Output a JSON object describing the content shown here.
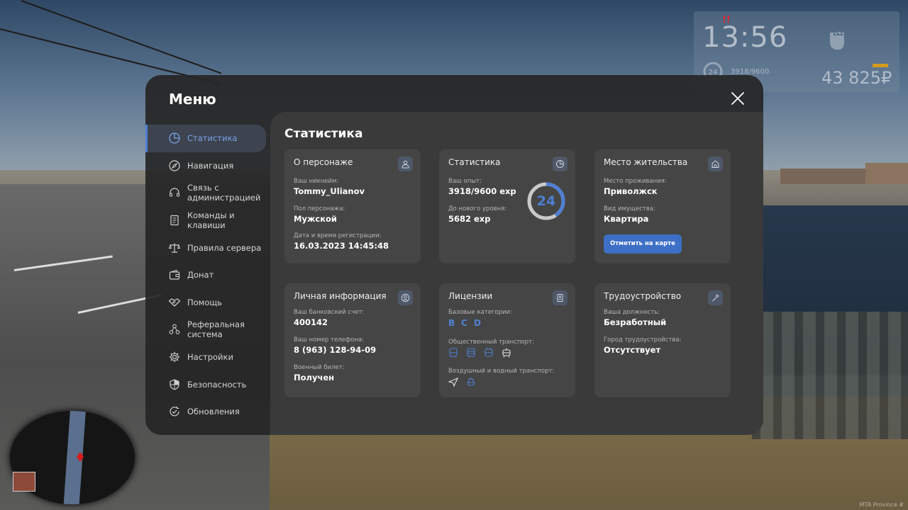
{
  "hud": {
    "time": "13:56",
    "alert": "!!",
    "level": "24",
    "exp": "3918/9600",
    "money": "43 825₽"
  },
  "watermark": "MTA Province #",
  "menu": {
    "title": "Меню",
    "sidebar": [
      {
        "label": "Статистика",
        "icon": "pie-chart-icon",
        "active": true
      },
      {
        "label": "Навигация",
        "icon": "compass-icon"
      },
      {
        "label": "Связь с администрацией",
        "icon": "headset-icon"
      },
      {
        "label": "Команды и клавиши",
        "icon": "document-icon"
      },
      {
        "label": "Правила сервера",
        "icon": "scales-icon"
      },
      {
        "label": "Донат",
        "icon": "wallet-icon"
      },
      {
        "label": "Помощь",
        "icon": "handshake-icon"
      },
      {
        "label": "Реферальная система",
        "icon": "network-icon"
      },
      {
        "label": "Настройки",
        "icon": "gear-icon"
      },
      {
        "label": "Безопасность",
        "icon": "shield-icon"
      },
      {
        "label": "Обновления",
        "icon": "refresh-check-icon"
      }
    ]
  },
  "content": {
    "title": "Статистика",
    "character": {
      "title": "О персонаже",
      "nickname_label": "Ваш никнейм:",
      "nickname": "Tommy_Ulianov",
      "gender_label": "Пол персонажа:",
      "gender": "Мужской",
      "reg_label": "Дата и время регистрации:",
      "reg": "16.03.2023 14:45:48"
    },
    "stats": {
      "title": "Статистика",
      "exp_label": "Ваш опыт:",
      "exp": "3918/9600 exp",
      "next_label": "До нового уровня:",
      "next": "5682 exp",
      "level": "24",
      "progress": 0.408
    },
    "residence": {
      "title": "Место жительства",
      "place_label": "Место проживания:",
      "place": "Приволжск",
      "property_label": "Вид имущества:",
      "property": "Квартира",
      "map_button": "Отметить на карте"
    },
    "personal": {
      "title": "Личная информация",
      "bank_label": "Ваш банковский счет:",
      "bank": "400142",
      "phone_label": "Ваш номер телефона:",
      "phone": "8 (963) 128-94-09",
      "military_label": "Военный билет:",
      "military": "Получен"
    },
    "licenses": {
      "title": "Лицензии",
      "base_label": "Базовые категории:",
      "categories": [
        "B",
        "C",
        "D"
      ],
      "public_label": "Общественный транспорт:",
      "air_label": "Воздушный и водный транспорт:"
    },
    "job": {
      "title": "Трудоустройство",
      "position_label": "Ваша должность:",
      "position": "Безработный",
      "city_label": "Город трудоустройства:",
      "city": "Отсутствует"
    }
  },
  "colors": {
    "accent": "#4f80d3",
    "panel": "#262626",
    "card": "#454545"
  }
}
